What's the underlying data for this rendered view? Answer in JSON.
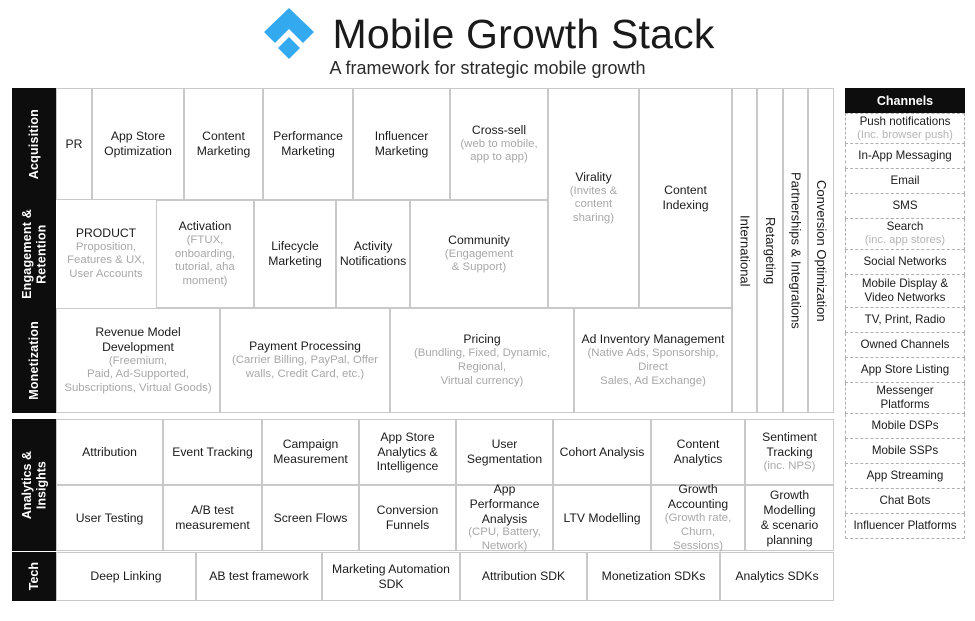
{
  "header": {
    "title": "Mobile Growth Stack",
    "subtitle": "A framework for strategic mobile growth",
    "logo_name": "mobile-growth-stack-logo",
    "logo_color": "#33aaf0"
  },
  "rails": {
    "acquisition": "Acquisition",
    "engagement": "Engagement &\nRetention",
    "monetization": "Monetization",
    "analytics": "Analytics &\nInsights",
    "tech": "Tech"
  },
  "acquisition": [
    {
      "title": "PR",
      "sub": ""
    },
    {
      "title": "App Store\nOptimization",
      "sub": ""
    },
    {
      "title": "Content\nMarketing",
      "sub": ""
    },
    {
      "title": "Performance\nMarketing",
      "sub": ""
    },
    {
      "title": "Influencer\nMarketing",
      "sub": ""
    },
    {
      "title": "Cross-sell",
      "sub": "(web to  mobile,\napp to app)"
    }
  ],
  "engagement": [
    {
      "title": "PRODUCT",
      "sub": "Proposition,\nFeatures & UX,\nUser Accounts"
    },
    {
      "title": "Activation",
      "sub": "(FTUX, onboarding,\ntutorial, aha\nmoment)"
    },
    {
      "title": "Lifecycle\nMarketing",
      "sub": ""
    },
    {
      "title": "Activity\nNotifications",
      "sub": ""
    },
    {
      "title": "Community",
      "sub": "(Engagement\n& Support)"
    }
  ],
  "spanning": [
    {
      "title": "Virality",
      "sub": "(Invites &\ncontent\nsharing)"
    },
    {
      "title": "Content Indexing",
      "sub": ""
    }
  ],
  "monetization": [
    {
      "title": "Revenue Model Development",
      "sub": "(Freemium,\nPaid, Ad-Supported,\nSubscriptions, Virtual Goods)"
    },
    {
      "title": "Payment Processing",
      "sub": "(Carrier Billing, PayPal, Offer\nwalls, Credit Card, etc.)"
    },
    {
      "title": "Pricing",
      "sub": "(Bundling, Fixed, Dynamic,\nRegional,\nVirtual currency)"
    },
    {
      "title": "Ad Inventory Management",
      "sub": "(Native Ads, Sponsorship, Direct\nSales, Ad Exchange)"
    }
  ],
  "vertical_columns": [
    {
      "title": "International"
    },
    {
      "title": "Retargeting"
    },
    {
      "title": "Partnerships & Integrations"
    },
    {
      "title": "Conversion Optimization"
    }
  ],
  "analytics_row1": [
    {
      "title": "Attribution",
      "sub": ""
    },
    {
      "title": "Event Tracking",
      "sub": ""
    },
    {
      "title": "Campaign\nMeasurement",
      "sub": ""
    },
    {
      "title": "App Store\nAnalytics &\nIntelligence",
      "sub": ""
    },
    {
      "title": "User\nSegmentation",
      "sub": ""
    },
    {
      "title": "Cohort Analysis",
      "sub": ""
    },
    {
      "title": "Content\nAnalytics",
      "sub": ""
    },
    {
      "title": "Sentiment\nTracking",
      "sub": "(inc. NPS)"
    }
  ],
  "analytics_row2": [
    {
      "title": "User Testing",
      "sub": ""
    },
    {
      "title": "A/B test\nmeasurement",
      "sub": ""
    },
    {
      "title": "Screen Flows",
      "sub": ""
    },
    {
      "title": "Conversion\nFunnels",
      "sub": ""
    },
    {
      "title": "App\nPerformance\nAnalysis",
      "sub": "(CPU, Battery,\nNetwork)"
    },
    {
      "title": "LTV Modelling",
      "sub": ""
    },
    {
      "title": "Growth\nAccounting",
      "sub": "(Growth rate,\nChurn, Sessions)"
    },
    {
      "title": "Growth Modelling\n& scenario planning",
      "sub": ""
    }
  ],
  "tech": [
    {
      "title": "Deep Linking",
      "sub": ""
    },
    {
      "title": "AB test framework",
      "sub": ""
    },
    {
      "title": "Marketing Automation\nSDK",
      "sub": ""
    },
    {
      "title": "Attribution SDK",
      "sub": ""
    },
    {
      "title": "Monetization SDKs",
      "sub": ""
    },
    {
      "title": "Analytics SDKs",
      "sub": ""
    }
  ],
  "channels": {
    "heading": "Channels",
    "items": [
      {
        "title": "Push notifications",
        "sub": "(Inc. browser push)"
      },
      {
        "title": "In-App Messaging",
        "sub": ""
      },
      {
        "title": "Email",
        "sub": ""
      },
      {
        "title": "SMS",
        "sub": ""
      },
      {
        "title": "Search",
        "sub": "(inc. app stores)"
      },
      {
        "title": "Social Networks",
        "sub": ""
      },
      {
        "title": "Mobile Display &\nVideo Networks",
        "sub": ""
      },
      {
        "title": "TV, Print, Radio",
        "sub": ""
      },
      {
        "title": "Owned Channels",
        "sub": ""
      },
      {
        "title": "App Store Listing",
        "sub": ""
      },
      {
        "title": "Messenger\nPlatforms",
        "sub": ""
      },
      {
        "title": "Mobile DSPs",
        "sub": ""
      },
      {
        "title": "Mobile SSPs",
        "sub": ""
      },
      {
        "title": "App Streaming",
        "sub": ""
      },
      {
        "title": "Chat Bots",
        "sub": ""
      },
      {
        "title": "Influencer Platforms",
        "sub": ""
      }
    ]
  }
}
